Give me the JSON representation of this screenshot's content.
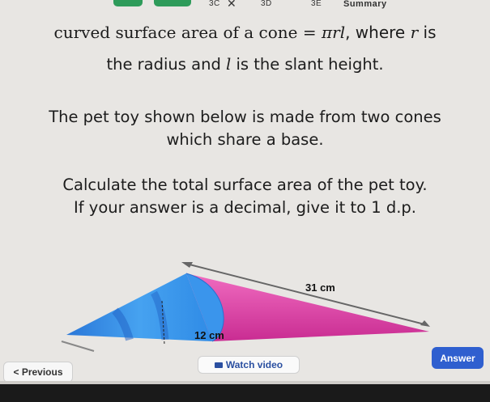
{
  "tabs": {
    "items": [
      {
        "label": "3C"
      },
      {
        "label": "3D"
      },
      {
        "label": "3E"
      },
      {
        "label": "Summary"
      }
    ],
    "close_glyph": "✕"
  },
  "question": {
    "formula_prefix": "curved surface area of a cone = ",
    "formula_math": "πrl",
    "formula_suffix": ", where ",
    "formula_var": "r",
    "formula_end": " is",
    "line2_prefix": "the radius and ",
    "line2_var": "l",
    "line2_suffix": " is the slant height.",
    "para2_line1": "The pet toy shown below is made from two cones",
    "para2_line2": "which share a base.",
    "para3_line1": "Calculate the total surface area of the pet toy.",
    "para3_line2": "If your answer is a decimal, give it to 1 d.p."
  },
  "diagram": {
    "slant_label": "31 cm",
    "radius_label": "12 cm",
    "colors": {
      "cone_pink": "#e23fa8",
      "cone_blue": "#2f8be6",
      "dark_blue": "#1f5fc4"
    }
  },
  "buttons": {
    "previous_label": "< Previous",
    "watch_label": "Watch video",
    "answer_label": "Answer",
    "answer_color": "#2f5fcf"
  }
}
